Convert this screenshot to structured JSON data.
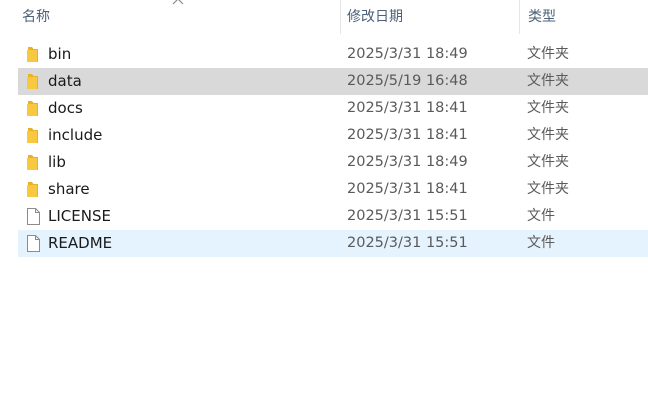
{
  "columns": {
    "name": "名称",
    "date": "修改日期",
    "type": "类型"
  },
  "sort_indicator_icon": "chevron-up-icon",
  "files": [
    {
      "name": "bin",
      "date": "2025/3/31 18:49",
      "type": "文件夹",
      "icon": "folder-icon",
      "state": "normal"
    },
    {
      "name": "data",
      "date": "2025/5/19 16:48",
      "type": "文件夹",
      "icon": "folder-icon",
      "state": "selected"
    },
    {
      "name": "docs",
      "date": "2025/3/31 18:41",
      "type": "文件夹",
      "icon": "folder-icon",
      "state": "normal"
    },
    {
      "name": "include",
      "date": "2025/3/31 18:41",
      "type": "文件夹",
      "icon": "folder-icon",
      "state": "normal"
    },
    {
      "name": "lib",
      "date": "2025/3/31 18:49",
      "type": "文件夹",
      "icon": "folder-icon",
      "state": "normal"
    },
    {
      "name": "share",
      "date": "2025/3/31 18:41",
      "type": "文件夹",
      "icon": "folder-icon",
      "state": "normal"
    },
    {
      "name": "LICENSE",
      "date": "2025/3/31 15:51",
      "type": "文件",
      "icon": "file-icon",
      "state": "normal"
    },
    {
      "name": "README",
      "date": "2025/3/31 15:51",
      "type": "文件",
      "icon": "file-icon",
      "state": "hover"
    }
  ],
  "colors": {
    "header_text": "#4c607a",
    "selected_row": "#d9d9d9",
    "hover_row": "#e5f3ff",
    "folder": "#f8c940"
  }
}
